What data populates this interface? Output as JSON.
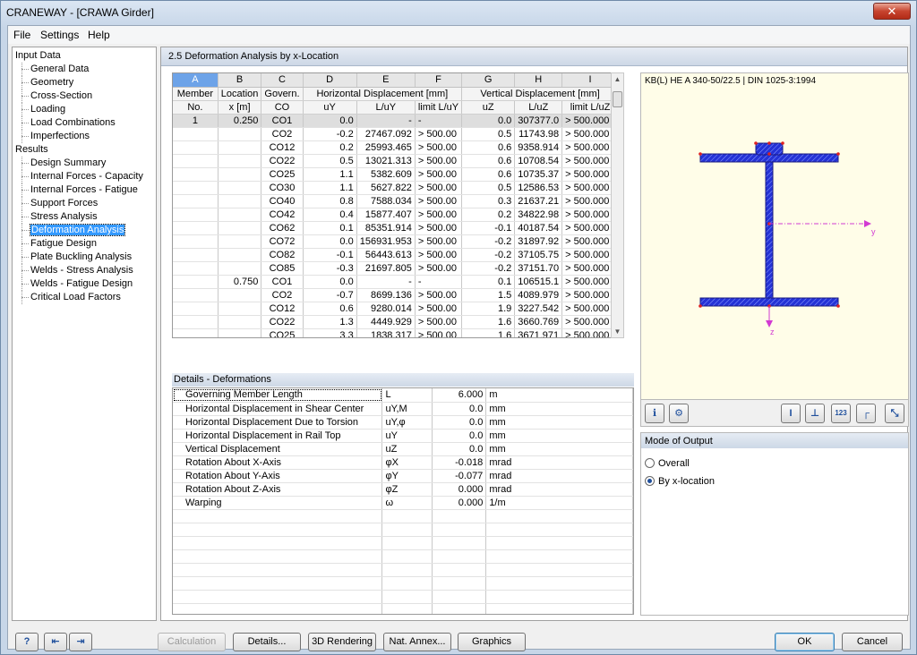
{
  "window": {
    "title": "CRANEWAY - [CRAWA Girder]",
    "close": "✕"
  },
  "menu": [
    "File",
    "Settings",
    "Help"
  ],
  "tree": [
    {
      "label": "Input Data",
      "level": 0
    },
    {
      "label": "General Data",
      "level": 1
    },
    {
      "label": "Geometry",
      "level": 1
    },
    {
      "label": "Cross-Section",
      "level": 1
    },
    {
      "label": "Loading",
      "level": 1
    },
    {
      "label": "Load Combinations",
      "level": 1
    },
    {
      "label": "Imperfections",
      "level": 1
    },
    {
      "label": "Results",
      "level": 0
    },
    {
      "label": "Design Summary",
      "level": 1
    },
    {
      "label": "Internal Forces - Capacity",
      "level": 1
    },
    {
      "label": "Internal Forces - Fatigue",
      "level": 1
    },
    {
      "label": "Support Forces",
      "level": 1
    },
    {
      "label": "Stress Analysis",
      "level": 1
    },
    {
      "label": "Deformation Analysis",
      "level": 1,
      "selected": true
    },
    {
      "label": "Fatigue Design",
      "level": 1
    },
    {
      "label": "Plate Buckling Analysis",
      "level": 1
    },
    {
      "label": "Welds - Stress Analysis",
      "level": 1
    },
    {
      "label": "Welds - Fatigue Design",
      "level": 1
    },
    {
      "label": "Critical Load Factors",
      "level": 1
    }
  ],
  "panel_title": "2.5 Deformation Analysis by x-Location",
  "grid": {
    "letters": [
      "A",
      "B",
      "C",
      "D",
      "E",
      "F",
      "G",
      "H",
      "I"
    ],
    "header1": {
      "member": "Member",
      "location": "Location",
      "govern": "Govern.",
      "horizontal": "Horizontal Displacement [mm]",
      "vertical": "Vertical Displacement [mm]"
    },
    "header2": [
      "No.",
      "x [m]",
      "CO",
      "uY",
      "L/uY",
      "limit L/uY",
      "uZ",
      "L/uZ",
      "limit L/uZ"
    ],
    "rows": [
      [
        "1",
        "0.250",
        "CO1",
        "0.0",
        "-",
        "-",
        "0.0",
        "307377.0",
        "> 500.000"
      ],
      [
        "",
        "",
        "CO2",
        "-0.2",
        "27467.092",
        "> 500.00",
        "0.5",
        "11743.98",
        "> 500.000"
      ],
      [
        "",
        "",
        "CO12",
        "0.2",
        "25993.465",
        "> 500.00",
        "0.6",
        "9358.914",
        "> 500.000"
      ],
      [
        "",
        "",
        "CO22",
        "0.5",
        "13021.313",
        "> 500.00",
        "0.6",
        "10708.54",
        "> 500.000"
      ],
      [
        "",
        "",
        "CO25",
        "1.1",
        "5382.609",
        "> 500.00",
        "0.6",
        "10735.37",
        "> 500.000"
      ],
      [
        "",
        "",
        "CO30",
        "1.1",
        "5627.822",
        "> 500.00",
        "0.5",
        "12586.53",
        "> 500.000"
      ],
      [
        "",
        "",
        "CO40",
        "0.8",
        "7588.034",
        "> 500.00",
        "0.3",
        "21637.21",
        "> 500.000"
      ],
      [
        "",
        "",
        "CO42",
        "0.4",
        "15877.407",
        "> 500.00",
        "0.2",
        "34822.98",
        "> 500.000"
      ],
      [
        "",
        "",
        "CO62",
        "0.1",
        "85351.914",
        "> 500.00",
        "-0.1",
        "40187.54",
        "> 500.000"
      ],
      [
        "",
        "",
        "CO72",
        "0.0",
        "156931.953",
        "> 500.00",
        "-0.2",
        "31897.92",
        "> 500.000"
      ],
      [
        "",
        "",
        "CO82",
        "-0.1",
        "56443.613",
        "> 500.00",
        "-0.2",
        "37105.75",
        "> 500.000"
      ],
      [
        "",
        "",
        "CO85",
        "-0.3",
        "21697.805",
        "> 500.00",
        "-0.2",
        "37151.70",
        "> 500.000"
      ],
      [
        "",
        "0.750",
        "CO1",
        "0.0",
        "-",
        "-",
        "0.1",
        "106515.1",
        "> 500.000"
      ],
      [
        "",
        "",
        "CO2",
        "-0.7",
        "8699.136",
        "> 500.00",
        "1.5",
        "4089.979",
        "> 500.000"
      ],
      [
        "",
        "",
        "CO12",
        "0.6",
        "9280.014",
        "> 500.00",
        "1.9",
        "3227.542",
        "> 500.000"
      ],
      [
        "",
        "",
        "CO22",
        "1.3",
        "4449.929",
        "> 500.00",
        "1.6",
        "3660.769",
        "> 500.000"
      ],
      [
        "",
        "",
        "CO25",
        "3.3",
        "1838.317",
        "> 500.00",
        "1.6",
        "3671.971",
        "> 500.000"
      ]
    ]
  },
  "details": {
    "title": "Details - Deformations",
    "rows": [
      [
        "Governing Member Length",
        "L",
        "6.000",
        "m"
      ],
      [
        "Horizontal Displacement in Shear Center",
        "uY,M",
        "0.0",
        "mm"
      ],
      [
        "Horizontal Displacement Due to Torsion",
        "uY,φ",
        "0.0",
        "mm"
      ],
      [
        "Horizontal Displacement in Rail Top",
        "uY",
        "0.0",
        "mm"
      ],
      [
        "Vertical Displacement",
        "uZ",
        "0.0",
        "mm"
      ],
      [
        "Rotation About X-Axis",
        "φX",
        "-0.018",
        "mrad"
      ],
      [
        "Rotation About Y-Axis",
        "φY",
        "-0.077",
        "mrad"
      ],
      [
        "Rotation About Z-Axis",
        "φZ",
        "0.000",
        "mrad"
      ],
      [
        "Warping",
        "ω",
        "0.000",
        "1/m"
      ]
    ],
    "empty_rows": 8
  },
  "preview": {
    "caption": "KB(L) HE A 340-50/22.5 | DIN 1025-3:1994",
    "axis_y": "y",
    "axis_z": "z",
    "section_color": "#2432d6",
    "axis_color": "#d23ad2"
  },
  "output": {
    "title": "Mode of Output",
    "overall": "Overall",
    "by_x": "By x-location",
    "selected": "by_x"
  },
  "buttons": {
    "calculation": "Calculation",
    "details": "Details...",
    "rendering": "3D Rendering",
    "annex": "Nat. Annex...",
    "graphics": "Graphics",
    "ok": "OK",
    "cancel": "Cancel"
  }
}
